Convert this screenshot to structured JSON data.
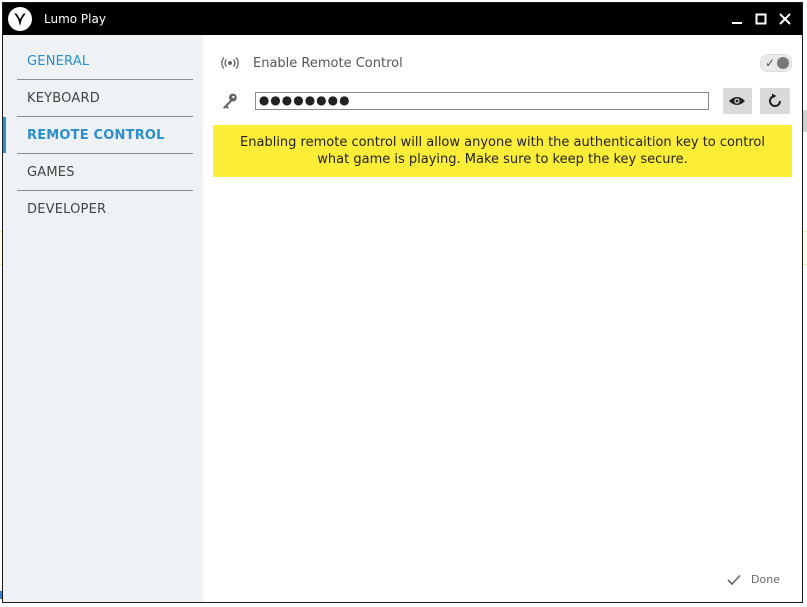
{
  "window": {
    "title": "Lumo Play"
  },
  "sidebar": {
    "items": [
      {
        "label": "GENERAL"
      },
      {
        "label": "KEYBOARD"
      },
      {
        "label": "REMOTE CONTROL"
      },
      {
        "label": "GAMES"
      },
      {
        "label": "DEVELOPER"
      }
    ]
  },
  "remote": {
    "enable_label": "Enable Remote Control",
    "enabled": true,
    "key_value": "●●●●●●●●",
    "warning": "Enabling remote control will allow anyone with the authenticaition key to control what game is playing. Make sure to keep the key secure."
  },
  "footer": {
    "done_label": "Done"
  },
  "colors": {
    "accent": "#2a8ecf",
    "warning_bg": "#fcee36",
    "titlebar": "#000000",
    "sidebar_bg": "#eef2f4"
  }
}
